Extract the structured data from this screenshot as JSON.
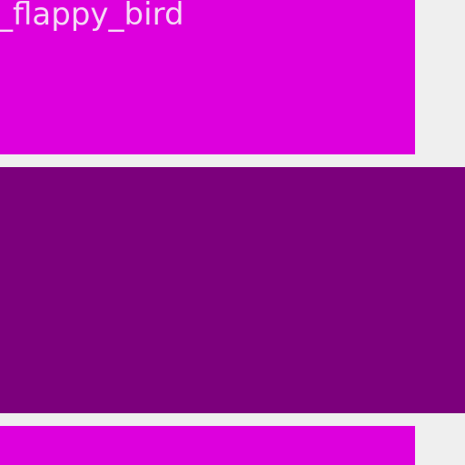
{
  "colors": {
    "background": "#efefef",
    "tile_primary": "#dd00dd",
    "tile_selected": "#7c007c",
    "label_text": "#f6d8f6"
  },
  "tiles": [
    {
      "label": "_flappy_bird",
      "state": "normal"
    },
    {
      "label": "",
      "state": "selected"
    },
    {
      "label": "",
      "state": "normal"
    }
  ]
}
